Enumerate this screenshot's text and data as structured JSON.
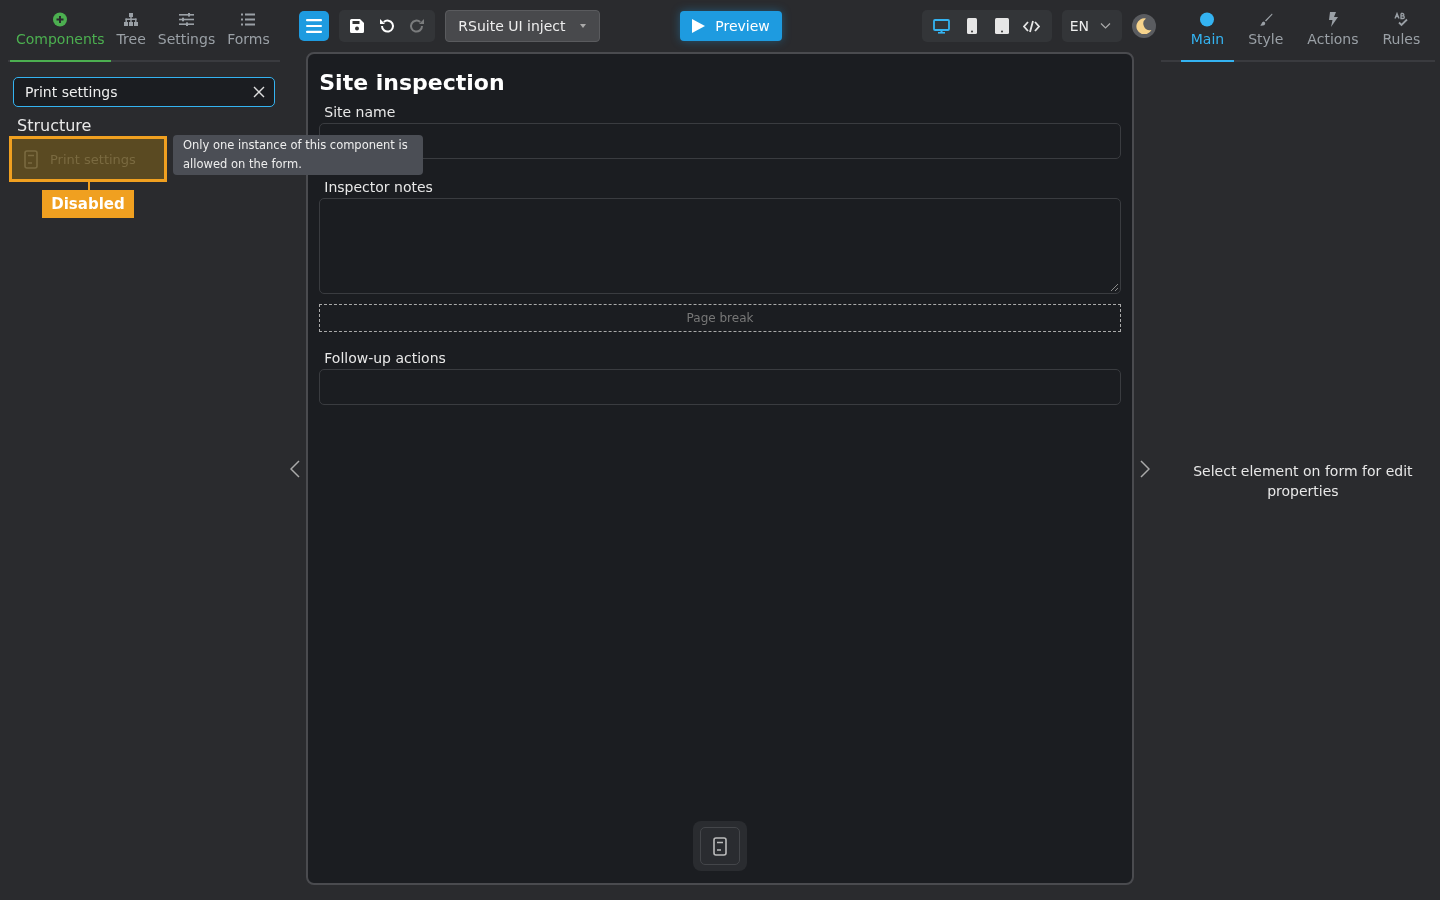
{
  "left_tabs": [
    {
      "label": "Components",
      "selected": true
    },
    {
      "label": "Tree",
      "selected": false
    },
    {
      "label": "Settings",
      "selected": false
    },
    {
      "label": "Forms",
      "selected": false
    }
  ],
  "search": {
    "value": "Print settings"
  },
  "section_title": "Structure",
  "components": [
    {
      "label": "Print settings",
      "disabled": true,
      "tooltip": "Only one instance of this component is allowed on the form.",
      "annotation": "Disabled"
    }
  ],
  "toolbar": {
    "theme_select": "RSuite UI inject",
    "preview": "Preview",
    "redo_disabled": true,
    "devices": [
      {
        "kind": "desktop",
        "selected": true
      },
      {
        "kind": "phone",
        "selected": false
      },
      {
        "kind": "tablet",
        "selected": false
      },
      {
        "kind": "code",
        "selected": false
      }
    ],
    "language": "EN"
  },
  "form": {
    "title": "Site inspection",
    "fields": [
      {
        "kind": "input",
        "label": "Site name"
      },
      {
        "kind": "textarea",
        "label": "Inspector notes"
      },
      {
        "kind": "pagebreak",
        "label": "Page break"
      },
      {
        "kind": "input",
        "label": "Follow-up actions"
      }
    ]
  },
  "right_tabs": [
    {
      "label": "Main",
      "selected": true
    },
    {
      "label": "Style",
      "selected": false
    },
    {
      "label": "Actions",
      "selected": false
    },
    {
      "label": "Rules",
      "selected": false
    }
  ],
  "properties_hint": "Select element on form for edit properties"
}
